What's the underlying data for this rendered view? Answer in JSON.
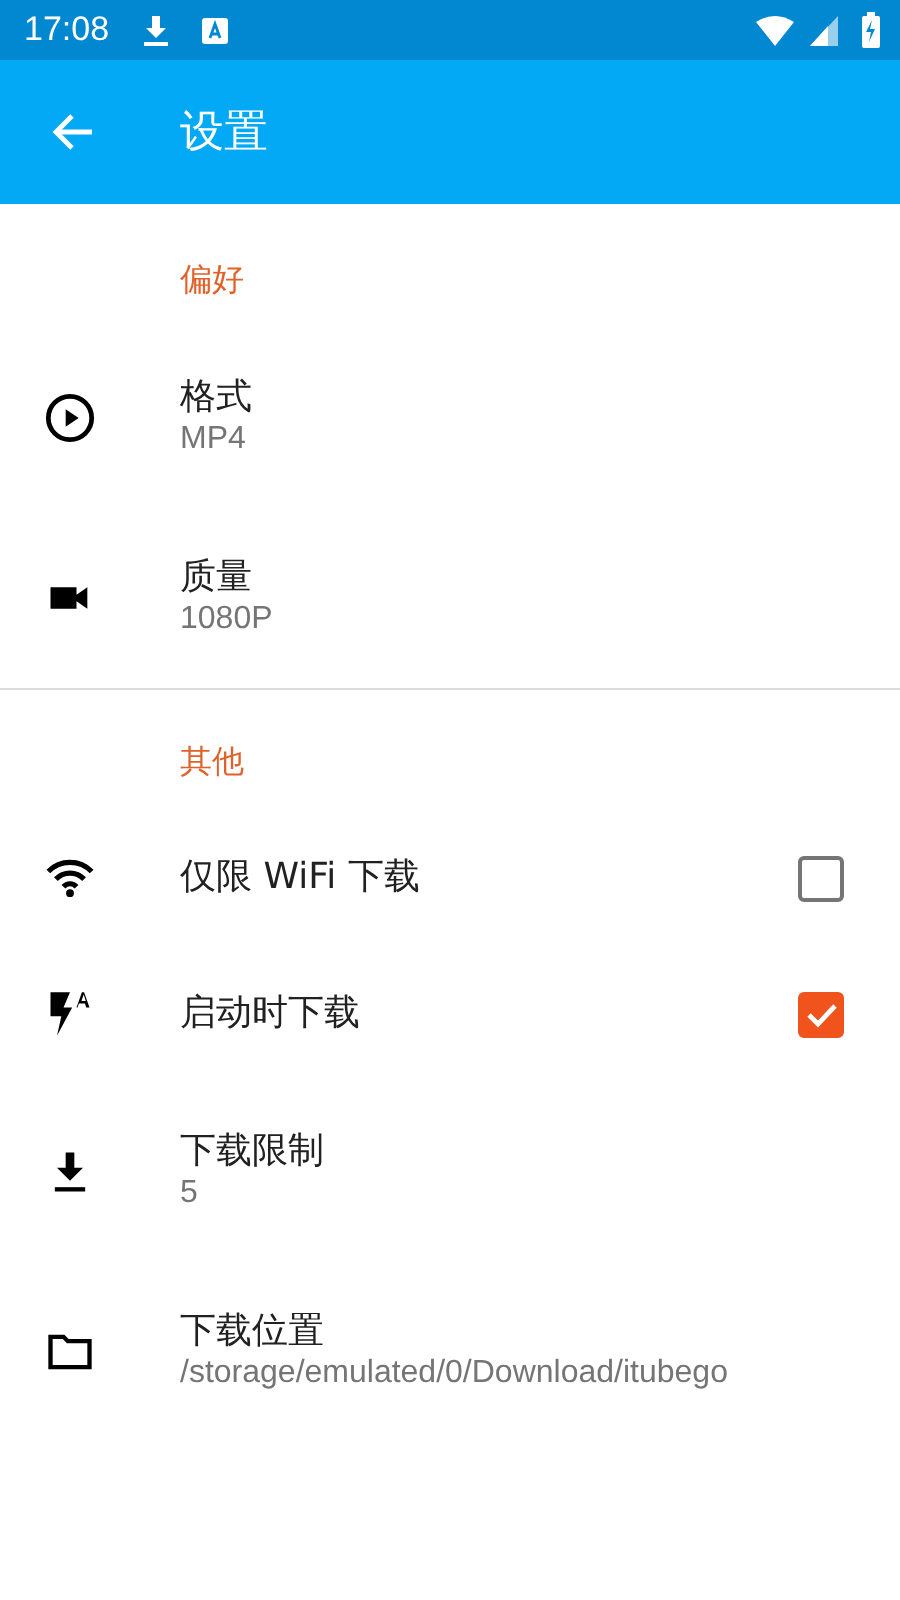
{
  "status_bar": {
    "time": "17:08"
  },
  "app_bar": {
    "title": "设置"
  },
  "sections": [
    {
      "title": "偏好",
      "items": [
        {
          "kind": "value",
          "title": "格式",
          "summary": "MP4"
        },
        {
          "kind": "value",
          "title": "质量",
          "summary": "1080P"
        }
      ]
    },
    {
      "title": "其他",
      "items": [
        {
          "kind": "checkbox",
          "title": "仅限 WiFi 下载",
          "checked": false
        },
        {
          "kind": "checkbox",
          "title": "启动时下载",
          "checked": true
        },
        {
          "kind": "value",
          "title": "下载限制",
          "summary": "5"
        },
        {
          "kind": "value",
          "title": "下载位置",
          "summary": "/storage/emulated/0/Download/itubego"
        }
      ]
    }
  ]
}
